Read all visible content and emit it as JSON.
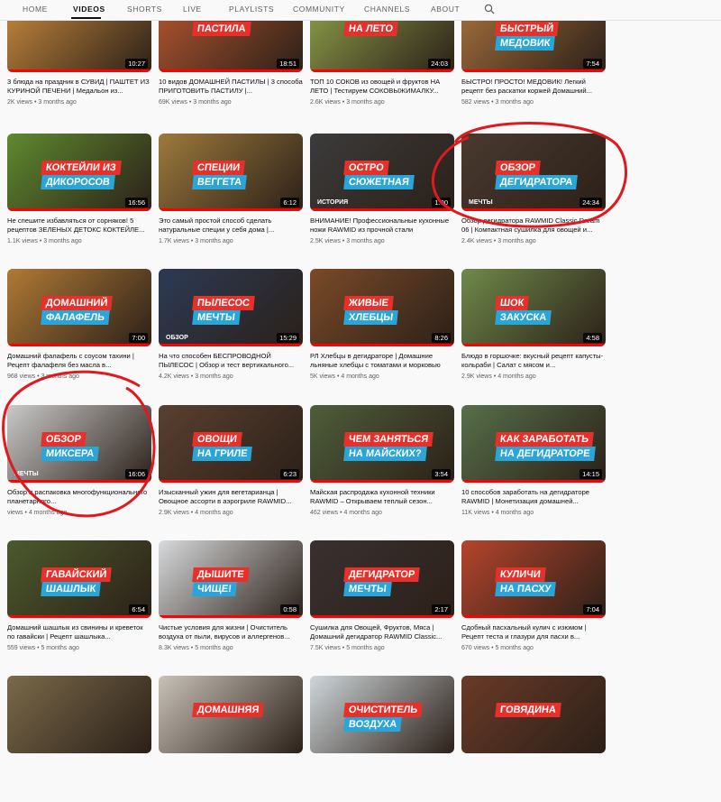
{
  "nav": {
    "tabs": [
      "HOME",
      "VIDEOS",
      "SHORTS",
      "LIVE",
      "PLAYLISTS",
      "COMMUNITY",
      "CHANNELS",
      "ABOUT"
    ],
    "active_tab": "VIDEOS"
  },
  "icons": {
    "search": "search-icon"
  },
  "colors": {
    "annotation": "#e0191f",
    "progress": "#ff0000",
    "accent_red": "#e8302a",
    "accent_blue": "#2aa5d8"
  },
  "videos": [
    {
      "l1": "",
      "l2": "",
      "tag": "",
      "duration": "10:27",
      "title": "3 блюда на праздник в СУВИД | ПАШТЕТ ИЗ КУРИНОЙ ПЕЧЕНИ | Медальон из...",
      "meta": "2K views • 3 months ago",
      "bg": "#c98a3d"
    },
    {
      "l1": "ПАСТИЛА",
      "l2": "",
      "tag": "",
      "duration": "18:51",
      "title": "10 видов ДОМАШНЕЙ ПАСТИЛЫ | 3 способа ПРИГОТОВИТЬ ПАСТИЛУ |...",
      "meta": "69K views • 3 months ago",
      "bg": "#b5562f"
    },
    {
      "l1": "НА ЛЕТО",
      "l2": "",
      "tag": "",
      "duration": "24:03",
      "title": "ТОП 10 СОКОВ из овощей и фруктов НА ЛЕТО | Тестируем СОКОВЫЖИМАЛКУ...",
      "meta": "2.6K views • 3 months ago",
      "bg": "#8fa04a"
    },
    {
      "l1": "БЫСТРЫЙ",
      "l2": "МЕДОВИК",
      "tag": "",
      "duration": "7:54",
      "title": "БЫСТРО! ПРОСТО! МЕДОВИК! Легкий рецепт без раскатки коржей Домашний...",
      "meta": "582 views • 3 months ago",
      "bg": "#a8723d"
    },
    {
      "l1": "КОКТЕЙЛИ ИЗ",
      "l2": "ДИКОРОСОВ",
      "tag": "",
      "duration": "16:56",
      "title": "Не спешите избавляться от сорняков! 5 рецептов ЗЕЛЕНЫХ ДЕТОКС КОКТЕЙЛЕ...",
      "meta": "1.1K views • 3 months ago",
      "bg": "#5f8a2f"
    },
    {
      "l1": "СПЕЦИИ",
      "l2": "ВЕГГЕТА",
      "tag": "",
      "duration": "6:12",
      "title": "Это самый простой способ сделать натуральные специи у себя дома |...",
      "meta": "1.7K views • 3 months ago",
      "bg": "#9d7a3c"
    },
    {
      "l1": "ОСТРО",
      "l2": "СЮЖЕТНАЯ",
      "tag": "ИСТОРИЯ",
      "duration": "1:00",
      "title": "ВНИМАНИЕ! Профессиональные кухонные ножи RAWMID из прочной стали",
      "meta": "2.5K views • 3 months ago",
      "bg": "#3b3b3b"
    },
    {
      "l1": "ОБЗОР",
      "l2": "ДЕГИДРАТОРА",
      "tag": "МЕЧТЫ",
      "duration": "24:34",
      "title": "Обзор дегидратора RAWMID Classic Dream 06 | Компактная сушилка для овощей и...",
      "meta": "2.4K views • 3 months ago",
      "bg": "#4a3a30"
    },
    {
      "l1": "ДОМАШНИЙ",
      "l2": "ФАЛАФЕЛЬ",
      "tag": "",
      "duration": "7:00",
      "title": "Домашний фалафель с соусом тахини | Рецепт фалафеля без масла в...",
      "meta": "968 views • 3 months ago",
      "bg": "#b07a35"
    },
    {
      "l1": "ПЫЛЕСОС",
      "l2": "МЕЧТЫ",
      "tag": "ОБЗОР",
      "duration": "15:29",
      "title": "На что способен БЕСПРОВОДНОЙ ПЫЛЕСОС | Обзор и тест вертикального...",
      "meta": "4.2K views • 3 months ago",
      "bg": "#2c3a55"
    },
    {
      "l1": "ЖИВЫЕ",
      "l2": "ХЛЕБЦЫ",
      "tag": "",
      "duration": "8:26",
      "title": "РЛ Хлебцы в дегидраторе | Домашние льняные хлебцы с томатами и морковью",
      "meta": "5K views • 4 months ago",
      "bg": "#7a4a28"
    },
    {
      "l1": "ШОК",
      "l2": "ЗАКУСКА",
      "tag": "",
      "duration": "4:58",
      "title": "Блюдо в горшочке: вкусный рецепт капусты-кольраби | Салат с мясом и...",
      "meta": "2.9K views • 4 months ago",
      "bg": "#6f8a4a"
    },
    {
      "l1": "ОБЗОР",
      "l2": "МИКСЕРА",
      "tag": "МЕЧТЫ",
      "duration": "16:06",
      "title": "Обзор и распаковка многофункционального планетарного...",
      "meta": "views • 4 months ago",
      "bg": "#c9c9c9"
    },
    {
      "l1": "ОВОЩИ",
      "l2": "НА ГРИЛЕ",
      "tag": "",
      "duration": "6:23",
      "title": "Изысканный ужин для вегетарианца | Овощное ассорти в аэрогриле RAWMID...",
      "meta": "2.9K views • 4 months ago",
      "bg": "#5a4030"
    },
    {
      "l1": "ЧЕМ ЗАНЯТЬСЯ",
      "l2": "НА МАЙСКИХ?",
      "tag": "",
      "duration": "3:54",
      "title": "Майская распродажа кухонной техники RAWMID – Открываем теплый сезон...",
      "meta": "462 views • 4 months ago",
      "bg": "#4f5e3a"
    },
    {
      "l1": "КАК ЗАРАБОТАТЬ",
      "l2": "НА ДЕГИДРАТОРЕ",
      "tag": "",
      "duration": "14:15",
      "title": "10 способов заработать на дегидраторе RAWMID | Монетизация домашней...",
      "meta": "11K views • 4 months ago",
      "bg": "#56704a"
    },
    {
      "l1": "ГАВАЙСКИЙ",
      "l2": "ШАШЛЫК",
      "tag": "",
      "duration": "6:54",
      "title": "Домашний шашлык из свинины и креветок по гавайски | Рецепт шашлыка...",
      "meta": "559 views • 5 months ago",
      "bg": "#4c5a2c"
    },
    {
      "l1": "ДЫШИТЕ",
      "l2": "ЧИЩЕ!",
      "tag": "",
      "duration": "0:58",
      "title": "Чистые условия для жизни | Очиститель воздуха от пыли, вирусов и аллергенов...",
      "meta": "8.3K views • 5 months ago",
      "bg": "#d8dadc"
    },
    {
      "l1": "ДЕГИДРАТОР",
      "l2": "МЕЧТЫ",
      "tag": "",
      "duration": "2:17",
      "title": "Сушилка для Овощей, Фруктов, Мяса | Домашний дегидратор RAWMID Classic...",
      "meta": "7.5K views • 5 months ago",
      "bg": "#3a3030"
    },
    {
      "l1": "КУЛИЧИ",
      "l2": "НА ПАСХУ",
      "tag": "",
      "duration": "7:04",
      "title": "Сдобный пасхальный кулич с изюмом | Рецепт теста и глазури для пасхи в...",
      "meta": "670 views • 5 months ago",
      "bg": "#b5442c"
    },
    {
      "l1": "",
      "l2": "",
      "tag": "",
      "duration": "",
      "title": "",
      "meta": "",
      "bg": "#7a6a4a"
    },
    {
      "l1": "ДОМАШНЯЯ",
      "l2": "",
      "tag": "",
      "duration": "",
      "title": "",
      "meta": "",
      "bg": "#c9c2b8"
    },
    {
      "l1": "ОЧИСТИТЕЛЬ",
      "l2": "ВОЗДУХА",
      "tag": "",
      "duration": "",
      "title": "",
      "meta": "",
      "bg": "#cfd6da"
    },
    {
      "l1": "ГОВЯДИНА",
      "l2": "",
      "tag": "",
      "duration": "",
      "title": "",
      "meta": "",
      "bg": "#6a3a28"
    }
  ]
}
